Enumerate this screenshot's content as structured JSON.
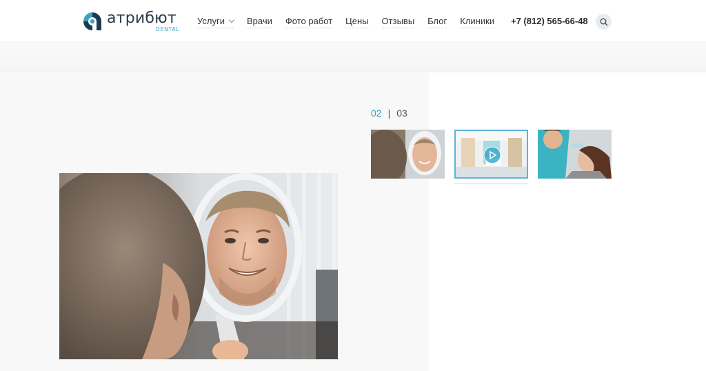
{
  "logo": {
    "name": "атрибют",
    "sub": "DENTAL"
  },
  "nav": [
    {
      "label": "Услуги",
      "has_dropdown": true
    },
    {
      "label": "Врачи"
    },
    {
      "label": "Фото работ"
    },
    {
      "label": "Цены"
    },
    {
      "label": "Отзывы"
    },
    {
      "label": "Блог"
    },
    {
      "label": "Клиники"
    }
  ],
  "phone": "+7 (812) 565-66-48",
  "slider": {
    "current": "02",
    "total": "03"
  },
  "colors": {
    "accent": "#2e9fc4",
    "brand_dark": "#2b3a4a",
    "panel_bg": "#f8f8f8"
  },
  "icons": {
    "search": "search-icon",
    "play": "play-icon",
    "dropdown": "chevron-down-icon"
  }
}
